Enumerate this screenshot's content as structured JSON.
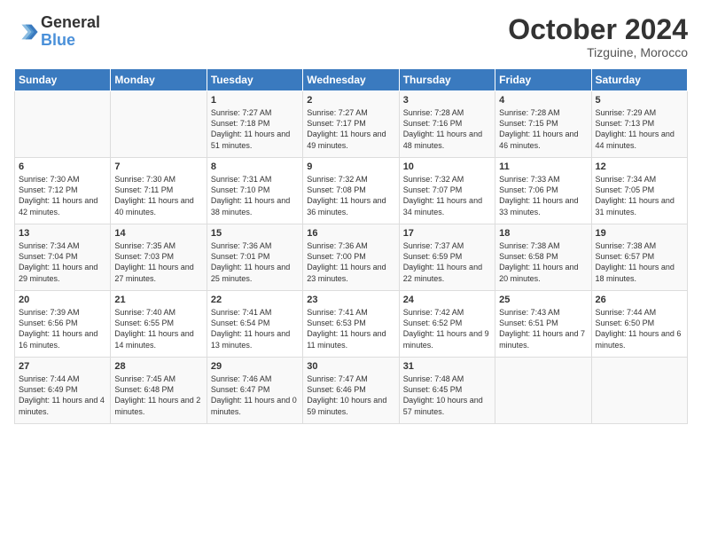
{
  "header": {
    "logo_line1": "General",
    "logo_line2": "Blue",
    "month": "October 2024",
    "location": "Tizguine, Morocco"
  },
  "days_of_week": [
    "Sunday",
    "Monday",
    "Tuesday",
    "Wednesday",
    "Thursday",
    "Friday",
    "Saturday"
  ],
  "weeks": [
    [
      {
        "day": "",
        "content": ""
      },
      {
        "day": "",
        "content": ""
      },
      {
        "day": "1",
        "content": "Sunrise: 7:27 AM\nSunset: 7:18 PM\nDaylight: 11 hours and 51 minutes."
      },
      {
        "day": "2",
        "content": "Sunrise: 7:27 AM\nSunset: 7:17 PM\nDaylight: 11 hours and 49 minutes."
      },
      {
        "day": "3",
        "content": "Sunrise: 7:28 AM\nSunset: 7:16 PM\nDaylight: 11 hours and 48 minutes."
      },
      {
        "day": "4",
        "content": "Sunrise: 7:28 AM\nSunset: 7:15 PM\nDaylight: 11 hours and 46 minutes."
      },
      {
        "day": "5",
        "content": "Sunrise: 7:29 AM\nSunset: 7:13 PM\nDaylight: 11 hours and 44 minutes."
      }
    ],
    [
      {
        "day": "6",
        "content": "Sunrise: 7:30 AM\nSunset: 7:12 PM\nDaylight: 11 hours and 42 minutes."
      },
      {
        "day": "7",
        "content": "Sunrise: 7:30 AM\nSunset: 7:11 PM\nDaylight: 11 hours and 40 minutes."
      },
      {
        "day": "8",
        "content": "Sunrise: 7:31 AM\nSunset: 7:10 PM\nDaylight: 11 hours and 38 minutes."
      },
      {
        "day": "9",
        "content": "Sunrise: 7:32 AM\nSunset: 7:08 PM\nDaylight: 11 hours and 36 minutes."
      },
      {
        "day": "10",
        "content": "Sunrise: 7:32 AM\nSunset: 7:07 PM\nDaylight: 11 hours and 34 minutes."
      },
      {
        "day": "11",
        "content": "Sunrise: 7:33 AM\nSunset: 7:06 PM\nDaylight: 11 hours and 33 minutes."
      },
      {
        "day": "12",
        "content": "Sunrise: 7:34 AM\nSunset: 7:05 PM\nDaylight: 11 hours and 31 minutes."
      }
    ],
    [
      {
        "day": "13",
        "content": "Sunrise: 7:34 AM\nSunset: 7:04 PM\nDaylight: 11 hours and 29 minutes."
      },
      {
        "day": "14",
        "content": "Sunrise: 7:35 AM\nSunset: 7:03 PM\nDaylight: 11 hours and 27 minutes."
      },
      {
        "day": "15",
        "content": "Sunrise: 7:36 AM\nSunset: 7:01 PM\nDaylight: 11 hours and 25 minutes."
      },
      {
        "day": "16",
        "content": "Sunrise: 7:36 AM\nSunset: 7:00 PM\nDaylight: 11 hours and 23 minutes."
      },
      {
        "day": "17",
        "content": "Sunrise: 7:37 AM\nSunset: 6:59 PM\nDaylight: 11 hours and 22 minutes."
      },
      {
        "day": "18",
        "content": "Sunrise: 7:38 AM\nSunset: 6:58 PM\nDaylight: 11 hours and 20 minutes."
      },
      {
        "day": "19",
        "content": "Sunrise: 7:38 AM\nSunset: 6:57 PM\nDaylight: 11 hours and 18 minutes."
      }
    ],
    [
      {
        "day": "20",
        "content": "Sunrise: 7:39 AM\nSunset: 6:56 PM\nDaylight: 11 hours and 16 minutes."
      },
      {
        "day": "21",
        "content": "Sunrise: 7:40 AM\nSunset: 6:55 PM\nDaylight: 11 hours and 14 minutes."
      },
      {
        "day": "22",
        "content": "Sunrise: 7:41 AM\nSunset: 6:54 PM\nDaylight: 11 hours and 13 minutes."
      },
      {
        "day": "23",
        "content": "Sunrise: 7:41 AM\nSunset: 6:53 PM\nDaylight: 11 hours and 11 minutes."
      },
      {
        "day": "24",
        "content": "Sunrise: 7:42 AM\nSunset: 6:52 PM\nDaylight: 11 hours and 9 minutes."
      },
      {
        "day": "25",
        "content": "Sunrise: 7:43 AM\nSunset: 6:51 PM\nDaylight: 11 hours and 7 minutes."
      },
      {
        "day": "26",
        "content": "Sunrise: 7:44 AM\nSunset: 6:50 PM\nDaylight: 11 hours and 6 minutes."
      }
    ],
    [
      {
        "day": "27",
        "content": "Sunrise: 7:44 AM\nSunset: 6:49 PM\nDaylight: 11 hours and 4 minutes."
      },
      {
        "day": "28",
        "content": "Sunrise: 7:45 AM\nSunset: 6:48 PM\nDaylight: 11 hours and 2 minutes."
      },
      {
        "day": "29",
        "content": "Sunrise: 7:46 AM\nSunset: 6:47 PM\nDaylight: 11 hours and 0 minutes."
      },
      {
        "day": "30",
        "content": "Sunrise: 7:47 AM\nSunset: 6:46 PM\nDaylight: 10 hours and 59 minutes."
      },
      {
        "day": "31",
        "content": "Sunrise: 7:48 AM\nSunset: 6:45 PM\nDaylight: 10 hours and 57 minutes."
      },
      {
        "day": "",
        "content": ""
      },
      {
        "day": "",
        "content": ""
      }
    ]
  ]
}
